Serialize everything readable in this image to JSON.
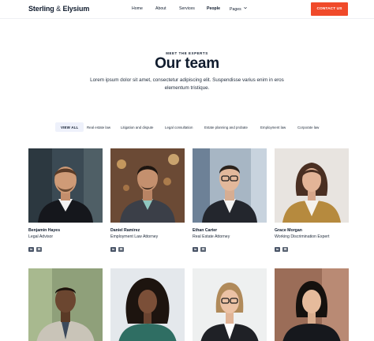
{
  "header": {
    "logo_main": "Sterling",
    "logo_amp": "&",
    "logo_tail": "Elysium",
    "menu": [
      {
        "label": "Home"
      },
      {
        "label": "About"
      },
      {
        "label": "Services"
      },
      {
        "label": "People"
      },
      {
        "label": "Pages"
      }
    ],
    "cta_label": "CONTACT US"
  },
  "hero": {
    "eyebrow": "MEET THE EXPERTS",
    "title": "Our team",
    "subtitle": "Lorem ipsum dolor sit amet, consectetur adipiscing elit. Suspendisse varius enim in eros elementum tristique."
  },
  "filters": [
    {
      "label": "VIEW ALL",
      "active": true
    },
    {
      "label": "Real estate law"
    },
    {
      "label": "Litigation and dispute"
    },
    {
      "label": "Legal consultation"
    },
    {
      "label": "Estate planning and probate"
    },
    {
      "label": "Employment law"
    },
    {
      "label": "Corporate law"
    }
  ],
  "team": [
    {
      "name": "Benjamin Hayes",
      "role": "Legal Advisor"
    },
    {
      "name": "Daniel Ramirez",
      "role": "Employment Law Attorney"
    },
    {
      "name": "Ethan Carter",
      "role": "Real Estate Attorney"
    },
    {
      "name": "Grace Morgan",
      "role": "Working Discrimination Expert"
    }
  ],
  "social_icons": [
    "linkedin-icon",
    "mail-icon"
  ],
  "colors": {
    "accent": "#f04a2a",
    "text": "#0f1b2d",
    "filter_active_bg": "#eef1fb"
  }
}
